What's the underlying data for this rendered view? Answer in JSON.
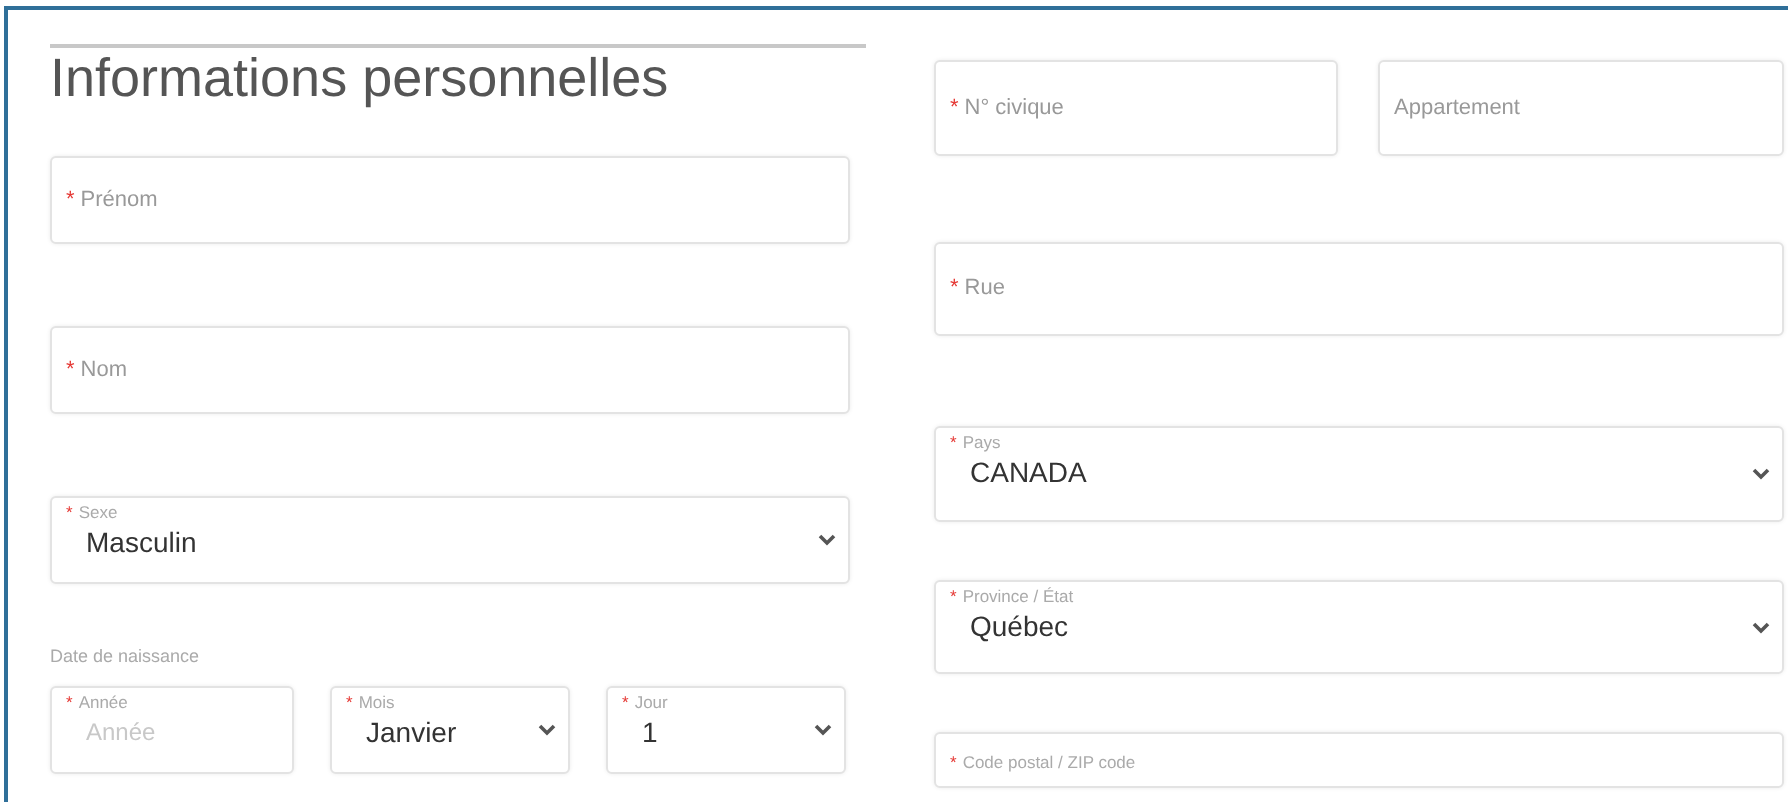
{
  "left": {
    "title": "Informations personnelles",
    "fields": [
      {
        "kind": "text",
        "required_mark": "*",
        "label": "Prénom"
      },
      {
        "kind": "text",
        "required_mark": "*",
        "label": "Nom"
      },
      {
        "kind": "select",
        "required_mark": "*",
        "label": "Sexe",
        "value": "Masculin"
      }
    ],
    "birth_date": {
      "label": "Date de naissance",
      "fields": [
        {
          "kind": "input",
          "required_mark": "*",
          "label": "Année",
          "placeholder": "Année"
        },
        {
          "kind": "select",
          "required_mark": "*",
          "label": "Mois",
          "value": "Janvier"
        },
        {
          "kind": "select",
          "required_mark": "*",
          "label": "Jour",
          "value": "1"
        }
      ]
    }
  },
  "right": {
    "address_row": [
      {
        "kind": "text",
        "required_mark": "*",
        "label": "N° civique"
      },
      {
        "kind": "text",
        "label": "Appartement"
      }
    ],
    "fields": [
      {
        "kind": "text",
        "required_mark": "*",
        "label": "Rue"
      },
      {
        "kind": "select",
        "required_mark": "*",
        "label": "Pays",
        "value": "CANADA"
      },
      {
        "kind": "select",
        "required_mark": "*",
        "label": "Province / État",
        "value": "Québec"
      },
      {
        "kind": "input",
        "required_mark": "*",
        "label": "Code postal / ZIP code"
      }
    ]
  }
}
